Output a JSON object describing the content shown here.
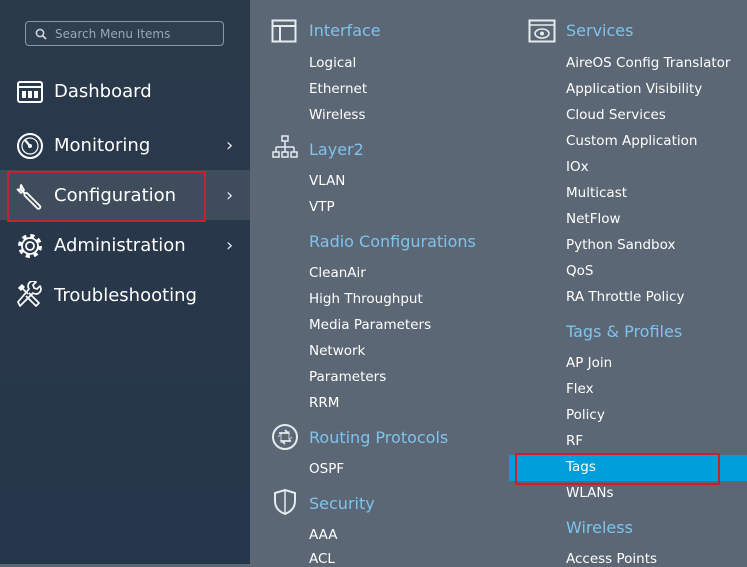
{
  "sidebar": {
    "search": {
      "placeholder": "Search Menu Items"
    },
    "items": [
      {
        "label": "Dashboard",
        "icon": "dashboard-icon"
      },
      {
        "label": "Monitoring",
        "icon": "gauge-icon",
        "chevron": "›"
      },
      {
        "label": "Configuration",
        "icon": "wrench-icon",
        "chevron": "›",
        "selected": true
      },
      {
        "label": "Administration",
        "icon": "gear-icon",
        "chevron": "›"
      },
      {
        "label": "Troubleshooting",
        "icon": "tools-icon"
      }
    ]
  },
  "menu": {
    "interface": {
      "title": "Interface",
      "icon": "window-icon",
      "items": [
        "Logical",
        "Ethernet",
        "Wireless"
      ]
    },
    "layer2": {
      "title": "Layer2",
      "icon": "network-tree-icon",
      "items": [
        "VLAN",
        "VTP"
      ]
    },
    "radio": {
      "title": "Radio Configurations",
      "items": [
        "CleanAir",
        "High Throughput",
        "Media Parameters",
        "Network",
        "Parameters",
        "RRM"
      ]
    },
    "routing": {
      "title": "Routing Protocols",
      "icon": "routing-icon",
      "items": [
        "OSPF"
      ]
    },
    "security": {
      "title": "Security",
      "icon": "shield-icon",
      "items": [
        "AAA",
        "ACL"
      ]
    },
    "services": {
      "title": "Services",
      "icon": "services-icon",
      "items": [
        "AireOS Config Translator",
        "Application Visibility",
        "Cloud Services",
        "Custom Application",
        "IOx",
        "Multicast",
        "NetFlow",
        "Python Sandbox",
        "QoS",
        "RA Throttle Policy"
      ]
    },
    "tags_profiles": {
      "title": "Tags & Profiles",
      "items": [
        "AP Join",
        "Flex",
        "Policy",
        "RF",
        "Tags",
        "WLANs"
      ],
      "selected": "Tags"
    },
    "wireless": {
      "title": "Wireless",
      "items": [
        "Access Points"
      ]
    }
  },
  "colors": {
    "accent": "#7fc3ee",
    "selected": "#009fdb",
    "highlight": "#c8202e",
    "panel": "#5b6774",
    "sidebar": "#2a3a4b"
  }
}
